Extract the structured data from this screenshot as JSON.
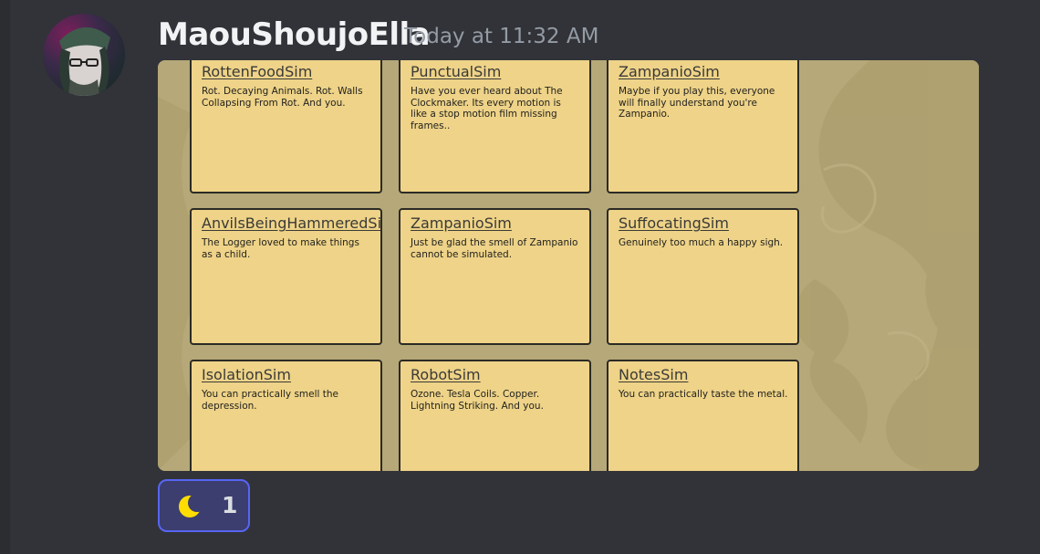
{
  "message": {
    "username": "MaouShoujoElla",
    "timestamp": "Today at 11:32 AM"
  },
  "attachment": {
    "cards": [
      {
        "title": "RottenFoodSim",
        "description": "Rot. Decaying Animals. Rot. Walls Collapsing From Rot. And you."
      },
      {
        "title": "PunctualSim",
        "description": "Have you ever heard about The Clockmaker. Its every motion is like a stop motion film missing frames.."
      },
      {
        "title": "ZampanioSim",
        "description": "Maybe if you play this, everyone will finally understand you're Zampanio."
      },
      {
        "title": "AnvilsBeingHammeredSim",
        "description": "The Logger loved to make things as a child."
      },
      {
        "title": "ZampanioSim",
        "description": "Just be glad the smell of Zampanio cannot be simulated."
      },
      {
        "title": "SuffocatingSim",
        "description": "Genuinely too much a happy sigh."
      },
      {
        "title": "IsolationSim",
        "description": "You can practically smell the depression."
      },
      {
        "title": "RobotSim",
        "description": "Ozone. Tesla Coils. Copper. Lightning Striking. And you."
      },
      {
        "title": "NotesSim",
        "description": "You can practically taste the metal."
      }
    ]
  },
  "reaction": {
    "emoji_icon": "crescent-moon-icon",
    "emoji_color": "#ffdd00",
    "count": "1"
  },
  "colors": {
    "background": "#313338",
    "username": "#f2f3f5",
    "timestamp": "#949ba4",
    "card": "#eed388",
    "reaction_border": "#5865f2"
  }
}
